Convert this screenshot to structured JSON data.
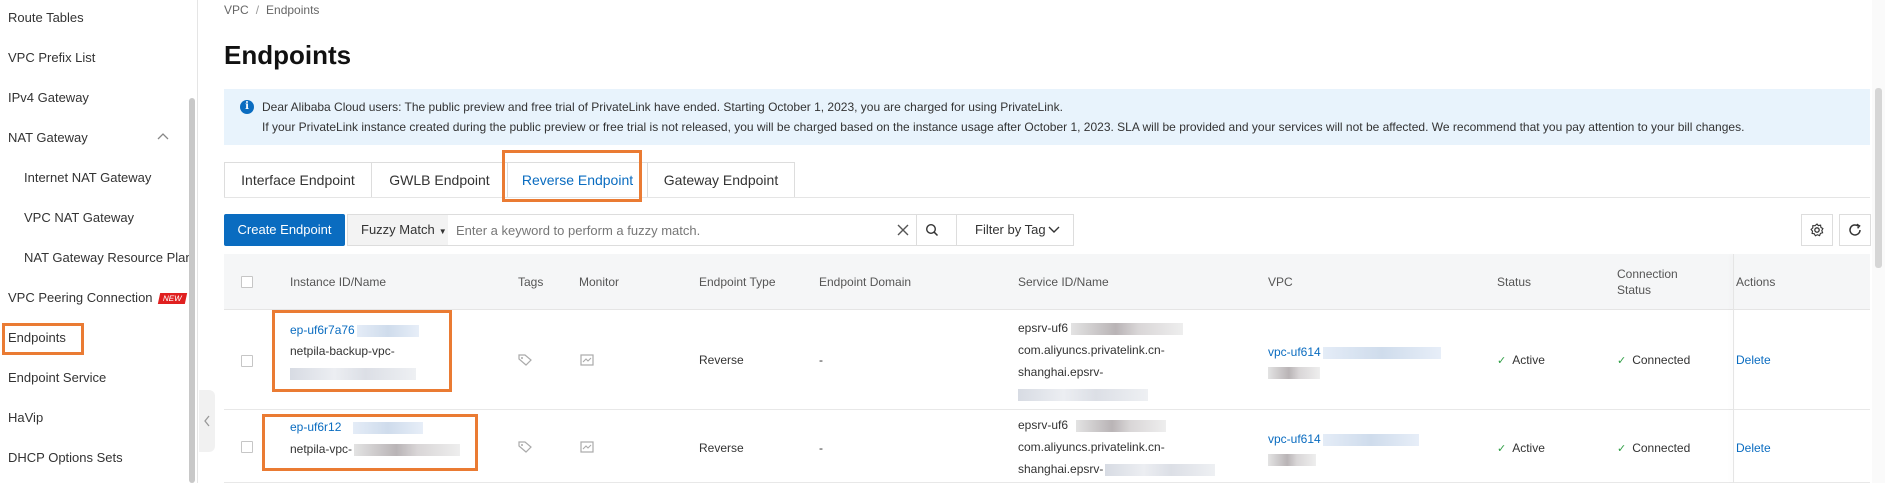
{
  "sidebar": {
    "items": [
      {
        "label": "Route Tables"
      },
      {
        "label": "VPC Prefix List"
      },
      {
        "label": "IPv4 Gateway"
      },
      {
        "label": "NAT Gateway"
      },
      {
        "label": "Internet NAT Gateway"
      },
      {
        "label": "VPC NAT Gateway"
      },
      {
        "label": "NAT Gateway Resource Plan"
      },
      {
        "label": "VPC Peering Connection",
        "badge": "NEW"
      },
      {
        "label": "Endpoints"
      },
      {
        "label": "Endpoint Service"
      },
      {
        "label": "HaVip"
      },
      {
        "label": "DHCP Options Sets"
      }
    ]
  },
  "breadcrumb": {
    "root": "VPC",
    "separator": "/",
    "current": "Endpoints"
  },
  "page": {
    "title": "Endpoints"
  },
  "notice": {
    "line1": "Dear Alibaba Cloud users: The public preview and free trial of PrivateLink have ended. Starting October 1, 2023, you are charged for using PrivateLink.",
    "line2": "If your PrivateLink instance created during the public preview or free trial is not released, you will be charged based on the instance usage after October 1, 2023. SLA will be provided and your services will not be affected. We recommend that you pay attention to your bill changes."
  },
  "tabs": [
    {
      "label": "Interface Endpoint"
    },
    {
      "label": "GWLB Endpoint"
    },
    {
      "label": "Reverse Endpoint",
      "active": true
    },
    {
      "label": "Gateway Endpoint"
    }
  ],
  "toolbar": {
    "create_label": "Create Endpoint",
    "fuzzy_label": "Fuzzy Match",
    "search_placeholder": "Enter a keyword to perform a fuzzy match.",
    "filter_label": "Filter by Tag"
  },
  "table": {
    "columns": {
      "instance": "Instance ID/Name",
      "tags": "Tags",
      "monitor": "Monitor",
      "type": "Endpoint Type",
      "domain": "Endpoint Domain",
      "service": "Service ID/Name",
      "vpc": "VPC",
      "status": "Status",
      "connection_line1": "Connection",
      "connection_line2": "Status",
      "actions": "Actions"
    },
    "rows": [
      {
        "instance_id": "ep-uf6r7a76",
        "instance_name": "netpila-backup-vpc-",
        "type": "Reverse",
        "domain": "-",
        "service_id": "epsrv-uf6",
        "service_name_1": "com.aliyuncs.privatelink.cn-",
        "service_name_2": "shanghai.epsrv-",
        "vpc": "vpc-uf614",
        "status": "Active",
        "connection": "Connected",
        "action": "Delete"
      },
      {
        "instance_id": "ep-uf6r12",
        "instance_name": "netpila-vpc-",
        "type": "Reverse",
        "domain": "-",
        "service_id": "epsrv-uf6",
        "service_name_1": "com.aliyuncs.privatelink.cn-",
        "service_name_2": "shanghai.epsrv-",
        "vpc": "vpc-uf614",
        "status": "Active",
        "connection": "Connected",
        "action": "Delete"
      }
    ]
  },
  "colors": {
    "accent": "#0a6cc0",
    "highlight": "#ea7b33",
    "notice_bg": "#e8f3fc",
    "success": "#2e9e44",
    "new_badge": "#e02020"
  },
  "icons": [
    "chevron-up-icon",
    "chevron-left-icon",
    "info-icon",
    "close-icon",
    "search-icon",
    "chevron-down-icon",
    "settings-icon",
    "refresh-icon",
    "tag-icon",
    "monitor-icon",
    "check-icon"
  ]
}
